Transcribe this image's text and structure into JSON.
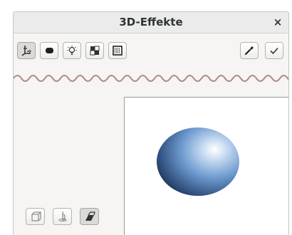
{
  "dialog": {
    "title": "3D-Effekte",
    "close_glyph": "×"
  },
  "toolbar": {
    "tabs": [
      {
        "name": "geometry",
        "icon": "axes-icon",
        "active": true
      },
      {
        "name": "shading",
        "icon": "rounded-rect-icon",
        "active": false
      },
      {
        "name": "illumination",
        "icon": "light-bulb-icon",
        "active": false
      },
      {
        "name": "textures",
        "icon": "checker-icon",
        "active": false
      },
      {
        "name": "material",
        "icon": "pattern-icon",
        "active": false
      }
    ],
    "actions": [
      {
        "name": "pick-object",
        "icon": "eyedropper-icon"
      },
      {
        "name": "assign",
        "icon": "checkmark-icon"
      }
    ]
  },
  "conversion_buttons": [
    {
      "name": "convert-to-3d",
      "icon": "convert-3d-icon",
      "active": false
    },
    {
      "name": "convert-to-rotation",
      "icon": "rotation-object-icon",
      "active": false
    },
    {
      "name": "perspective",
      "icon": "perspective-icon",
      "active": true
    }
  ],
  "colors": {
    "sphere_highlight": "#ffffff",
    "sphere_mid": "#6e9bd0",
    "sphere_dark": "#1c2e48",
    "wave_stroke": "#b38a86"
  }
}
